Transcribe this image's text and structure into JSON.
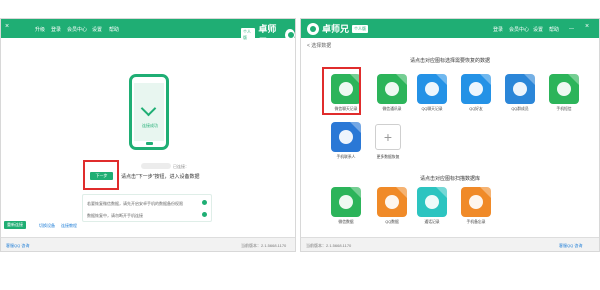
{
  "left_panel": {
    "topbar": {
      "close": "×",
      "menu_items": [
        "升级",
        "登录",
        "会员中心",
        "设置",
        "帮助"
      ],
      "logo_text": "卓师兄",
      "logo_badge": "个人版"
    },
    "phone_screen_text": "连接成功",
    "connected_label": "已连接：",
    "next_button": "下一步",
    "step_text": "请点击\"下一步\"按钮，进入设备数据",
    "tips": [
      "若要恢复微信数据，请先开启安卓手机的数据备份权限",
      "数据恢复中，请勿断开手机连接"
    ],
    "action_button": "重新连接",
    "links": [
      "切换设备",
      "连接教程"
    ],
    "bottom": {
      "left": "客服QQ 咨询",
      "right": "当前版本：2.1.5668.1170"
    }
  },
  "right_panel": {
    "topbar": {
      "logo_text": "卓师兄",
      "logo_badge": "个人版",
      "menu_items": [
        "登录",
        "会员中心",
        "设置",
        "帮助",
        "—",
        "×"
      ]
    },
    "breadcrumb": "< 选择数据",
    "section1_title": "请点击对应图标选择需要恢复的数据",
    "section2_title": "请点击对应图标扫描数据库",
    "tiles_row1": [
      {
        "label": "微信聊天记录",
        "color": "#2cb45a"
      },
      {
        "label": "微信通讯录",
        "color": "#2cb45a"
      },
      {
        "label": "QQ聊天记录",
        "color": "#2492e6"
      },
      {
        "label": "QQ好友",
        "color": "#2492e6"
      },
      {
        "label": "QQ群成员",
        "color": "#2b86d8"
      },
      {
        "label": "手机短信",
        "color": "#2cb45a"
      }
    ],
    "tiles_row2": [
      {
        "label": "手机联系人",
        "color": "#2a78d6"
      }
    ],
    "add_tile_label": "更多数据恢复",
    "tiles_row3": [
      {
        "label": "微信数据",
        "color": "#2cb45a"
      },
      {
        "label": "QQ数据",
        "color": "#f08a28"
      },
      {
        "label": "通话记录",
        "color": "#2cc4c0"
      },
      {
        "label": "手机备忘录",
        "color": "#f08a28"
      }
    ],
    "bottom": {
      "left": "当前版本：2.1.5668.1170",
      "right": "客服QQ 咨询"
    }
  }
}
